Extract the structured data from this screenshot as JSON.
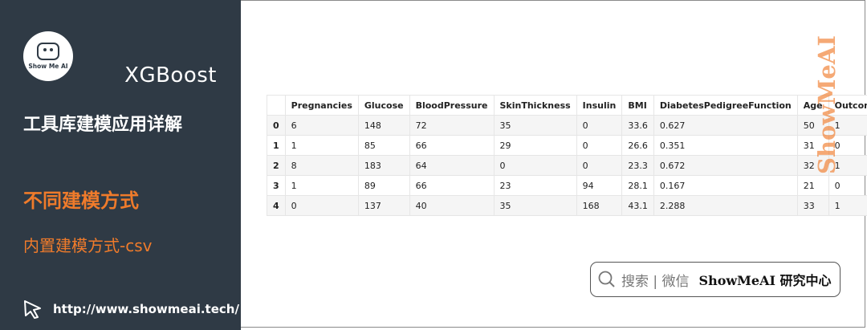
{
  "sidebar": {
    "logo_text": "Show Me AI",
    "brand_title": "XGBoost",
    "subtitle": "工具库建模应用详解",
    "section_title": "不同建模方式",
    "subsection_title": "内置建模方式-csv",
    "website": "http://www.showmeai.tech/"
  },
  "table": {
    "columns": [
      "",
      "Pregnancies",
      "Glucose",
      "BloodPressure",
      "SkinThickness",
      "Insulin",
      "BMI",
      "DiabetesPedigreeFunction",
      "Age",
      "Outcome"
    ],
    "rows": [
      [
        "0",
        "6",
        "148",
        "72",
        "35",
        "0",
        "33.6",
        "0.627",
        "50",
        "1"
      ],
      [
        "1",
        "1",
        "85",
        "66",
        "29",
        "0",
        "26.6",
        "0.351",
        "31",
        "0"
      ],
      [
        "2",
        "8",
        "183",
        "64",
        "0",
        "0",
        "23.3",
        "0.672",
        "32",
        "1"
      ],
      [
        "3",
        "1",
        "89",
        "66",
        "23",
        "94",
        "28.1",
        "0.167",
        "21",
        "0"
      ],
      [
        "4",
        "0",
        "137",
        "40",
        "35",
        "168",
        "43.1",
        "2.288",
        "33",
        "1"
      ]
    ]
  },
  "watermark": "ShowMeAI",
  "search": {
    "hint": "搜索 | 微信",
    "brand": "ShowMeAI 研究中心"
  },
  "colors": {
    "sidebar_bg": "#2f3a45",
    "accent": "#ef7b2b"
  }
}
